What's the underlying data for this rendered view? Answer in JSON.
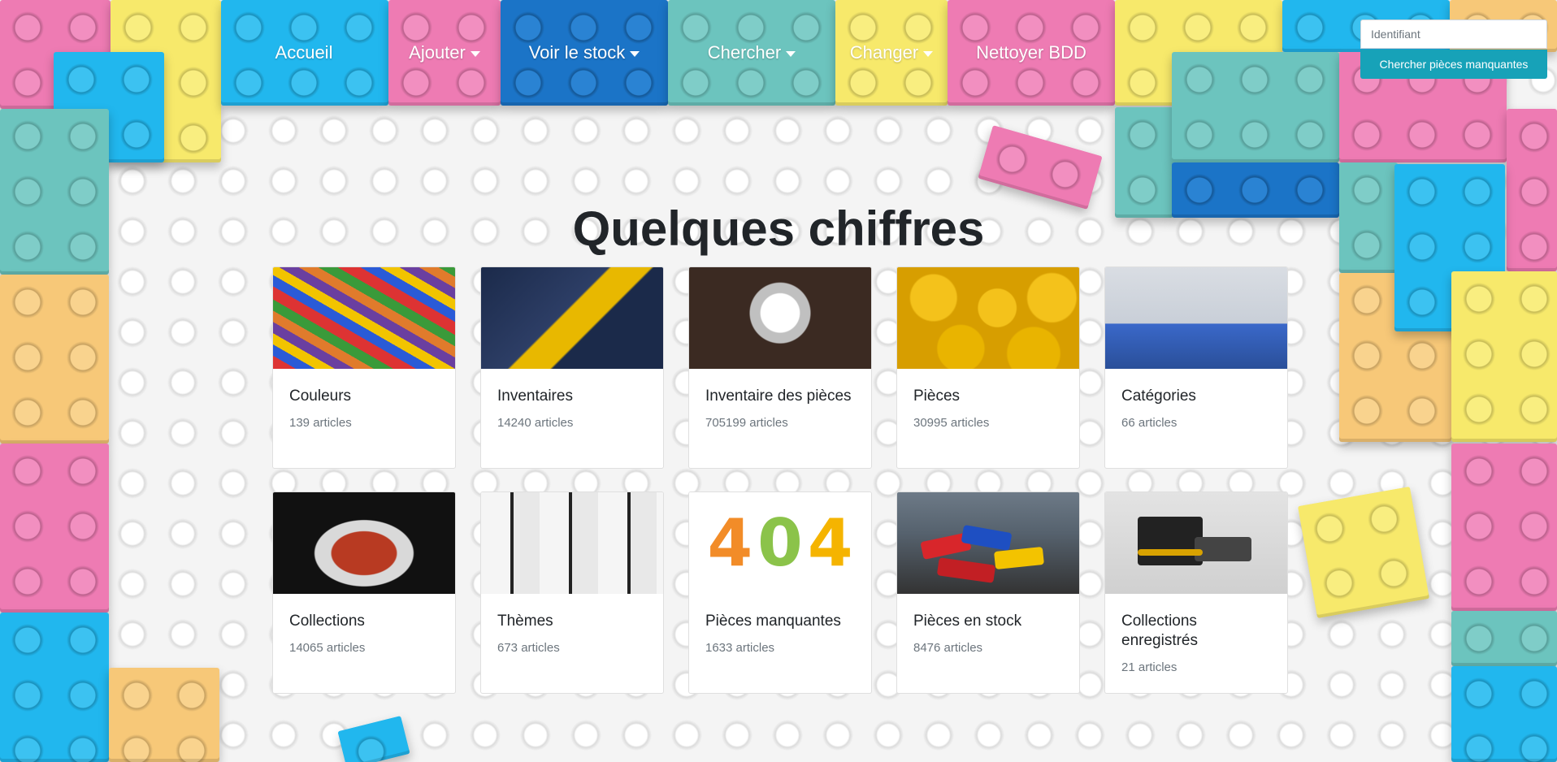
{
  "nav": {
    "items": [
      {
        "label": "Accueil",
        "has_dropdown": false,
        "color": "#21b7ee"
      },
      {
        "label": "Ajouter",
        "has_dropdown": true,
        "color": "#ee7bb3"
      },
      {
        "label": "Voir le stock",
        "has_dropdown": true,
        "color": "#1b74c7"
      },
      {
        "label": "Chercher",
        "has_dropdown": true,
        "color": "#6cc4be"
      },
      {
        "label": "Changer",
        "has_dropdown": true,
        "color": "#f7e96b"
      },
      {
        "label": "Nettoyer BDD",
        "has_dropdown": false,
        "color": "#ee7bb3"
      }
    ]
  },
  "search": {
    "placeholder": "Identifiant",
    "value": "",
    "button_label": "Chercher pièces manquantes",
    "button_color": "#17a2b8"
  },
  "page_title": "Quelques chiffres",
  "cards": [
    {
      "title": "Couleurs",
      "count": "139 articles",
      "image": "colorful-bricks-photo"
    },
    {
      "title": "Inventaires",
      "count": "14240 articles",
      "image": "technic-crane-photo"
    },
    {
      "title": "Inventaire des pièces",
      "count": "705199 articles",
      "image": "spaceship-parts-photo"
    },
    {
      "title": "Pièces",
      "count": "30995 articles",
      "image": "minifig-heads-photo"
    },
    {
      "title": "Catégories",
      "count": "66 articles",
      "image": "minifig-tennis-photo"
    },
    {
      "title": "Collections",
      "count": "14065 articles",
      "image": "monster-truck-photo"
    },
    {
      "title": "Thèmes",
      "count": "673 articles",
      "image": "stormtroopers-photo"
    },
    {
      "title": "Pièces manquantes",
      "count": "1633 articles",
      "image": "brick-404-photo"
    },
    {
      "title": "Pièces en stock",
      "count": "8476 articles",
      "image": "brick-pile-photo"
    },
    {
      "title": "Collections enregistrés",
      "count": "21 articles",
      "image": "truck-set-photo"
    }
  ],
  "image_404_text": [
    "4",
    "0",
    "4"
  ]
}
